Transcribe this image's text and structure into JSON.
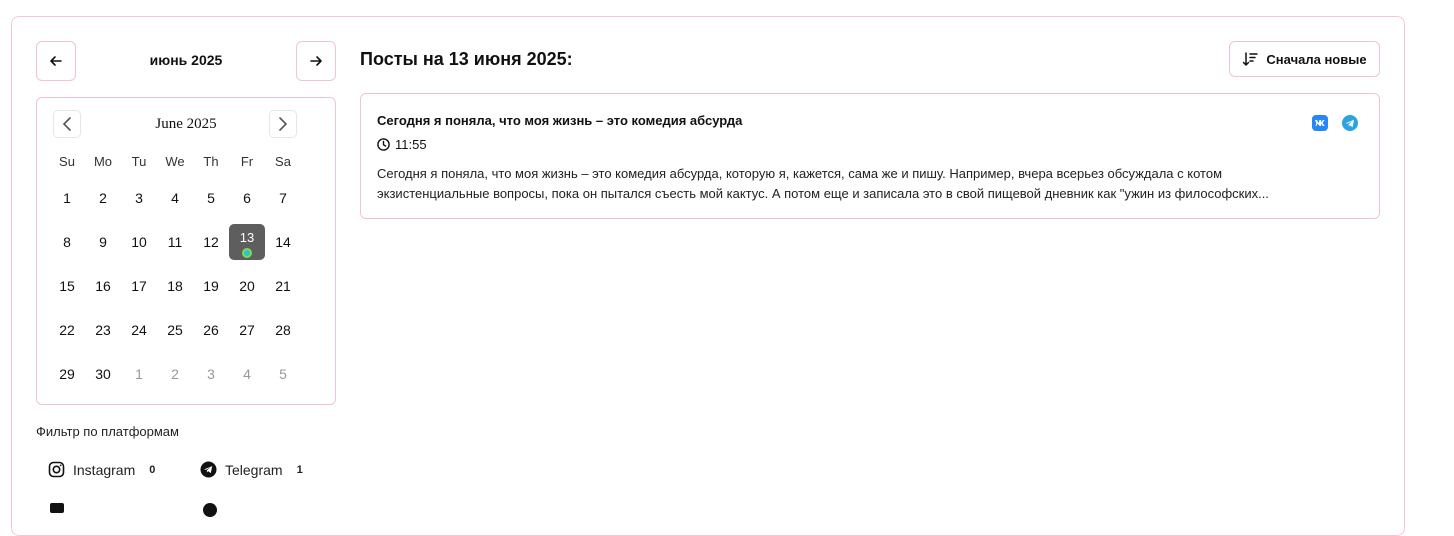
{
  "month_nav": {
    "title": "июнь 2025"
  },
  "calendar": {
    "caption": "June 2025",
    "weekdays": [
      "Su",
      "Mo",
      "Tu",
      "We",
      "Th",
      "Fr",
      "Sa"
    ],
    "weeks": [
      [
        "1",
        "2",
        "3",
        "4",
        "5",
        "6",
        "7"
      ],
      [
        "8",
        "9",
        "10",
        "11",
        "12",
        "13",
        "14"
      ],
      [
        "15",
        "16",
        "17",
        "18",
        "19",
        "20",
        "21"
      ],
      [
        "22",
        "23",
        "24",
        "25",
        "26",
        "27",
        "28"
      ],
      [
        "29",
        "30",
        "1",
        "2",
        "3",
        "4",
        "5"
      ]
    ],
    "selected_day": "13",
    "selected_week_index": 1,
    "selected_day_index": 5
  },
  "filter": {
    "title": "Фильтр по платформам",
    "platforms": [
      {
        "name": "Instagram",
        "count": "0",
        "icon": "instagram-icon"
      },
      {
        "name": "Telegram",
        "count": "1",
        "icon": "telegram-icon"
      }
    ]
  },
  "posts": {
    "title": "Посты на 13 июня 2025:",
    "sort_label": "Сначала новые",
    "items": [
      {
        "title": "Сегодня я поняла, что моя жизнь – это комедия абсурда",
        "time": "11:55",
        "text_line1": "Сегодня я поняла, что моя жизнь – это комедия абсурда, которую я, кажется, сама же и пишу. Например, вчера всерьез обсуждала с котом",
        "text_line2": "экзистенциальные вопросы, пока он пытался съесть мой кактус. А потом еще и записала это в свой пищевой дневник как \"ужин из философских...",
        "platforms": [
          "vk-icon",
          "telegram-icon"
        ]
      }
    ]
  },
  "colors": {
    "border_pink": "#f3c3d2",
    "selected_day_bg": "#5e5e5e",
    "vk_blue": "#2787f5",
    "telegram_blue": "#2aa3e0"
  }
}
